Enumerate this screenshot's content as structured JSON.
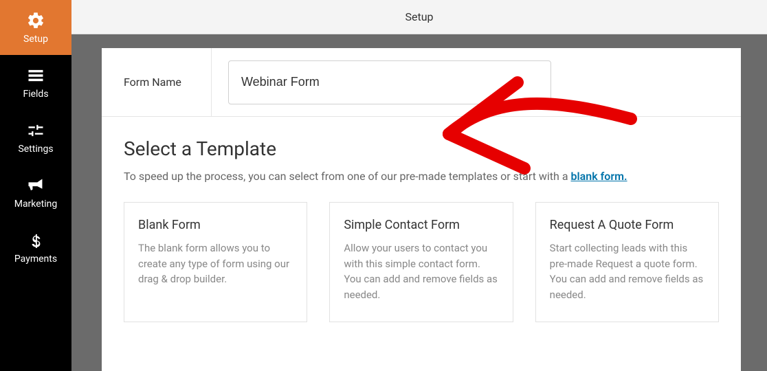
{
  "sidebar": {
    "items": [
      {
        "label": "Setup"
      },
      {
        "label": "Fields"
      },
      {
        "label": "Settings"
      },
      {
        "label": "Marketing"
      },
      {
        "label": "Payments"
      }
    ]
  },
  "topbar": {
    "title": "Setup"
  },
  "form_name": {
    "label": "Form Name",
    "value": "Webinar Form"
  },
  "template": {
    "heading": "Select a Template",
    "subtext_prefix": "To speed up the process, you can select from one of our pre-made templates or start with a ",
    "blank_link": "blank form.",
    "cards": [
      {
        "title": "Blank Form",
        "desc": "The blank form allows you to create any type of form using our drag & drop builder."
      },
      {
        "title": "Simple Contact Form",
        "desc": "Allow your users to contact you with this simple contact form. You can add and remove fields as needed."
      },
      {
        "title": "Request A Quote Form",
        "desc": "Start collecting leads with this pre-made Request a quote form. You can add and remove fields as needed."
      }
    ]
  }
}
